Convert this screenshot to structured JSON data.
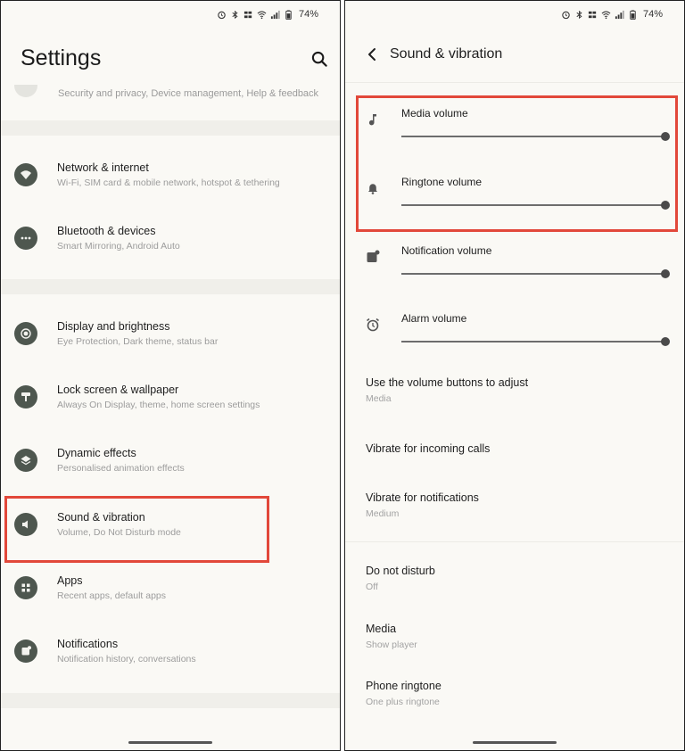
{
  "status": {
    "battery": "74%"
  },
  "left": {
    "title": "Settings",
    "partial_subtitle": "Security and privacy, Device management, Help & feedback",
    "items": [
      {
        "title": "Network & internet",
        "subtitle": "Wi-Fi, SIM card & mobile network, hotspot & tethering"
      },
      {
        "title": "Bluetooth & devices",
        "subtitle": "Smart Mirroring, Android Auto"
      },
      {
        "title": "Display and brightness",
        "subtitle": "Eye Protection, Dark theme, status bar"
      },
      {
        "title": "Lock screen & wallpaper",
        "subtitle": "Always On Display, theme, home screen settings"
      },
      {
        "title": "Dynamic effects",
        "subtitle": "Personalised animation effects"
      },
      {
        "title": "Sound & vibration",
        "subtitle": "Volume, Do Not Disturb mode"
      },
      {
        "title": "Apps",
        "subtitle": "Recent apps, default apps"
      },
      {
        "title": "Notifications",
        "subtitle": "Notification history, conversations"
      }
    ]
  },
  "right": {
    "title": "Sound & vibration",
    "volumes": [
      {
        "label": "Media volume",
        "level": 1.0
      },
      {
        "label": "Ringtone volume",
        "level": 1.0
      },
      {
        "label": "Notification volume",
        "level": 1.0
      },
      {
        "label": "Alarm volume",
        "level": 1.0
      }
    ],
    "volume_buttons": {
      "title": "Use the volume buttons to adjust",
      "subtitle": "Media"
    },
    "vibrate_calls": {
      "title": "Vibrate for incoming calls"
    },
    "vibrate_notifications": {
      "title": "Vibrate for notifications",
      "subtitle": "Medium"
    },
    "dnd": {
      "title": "Do not disturb",
      "subtitle": "Off"
    },
    "media": {
      "title": "Media",
      "subtitle": "Show player"
    },
    "phone_ringtone": {
      "title": "Phone ringtone",
      "subtitle": "One plus ringtone"
    }
  },
  "colors": {
    "highlight": "#e2483a",
    "icon_bg": "#4e574f",
    "screen_bg": "#faf9f5"
  }
}
